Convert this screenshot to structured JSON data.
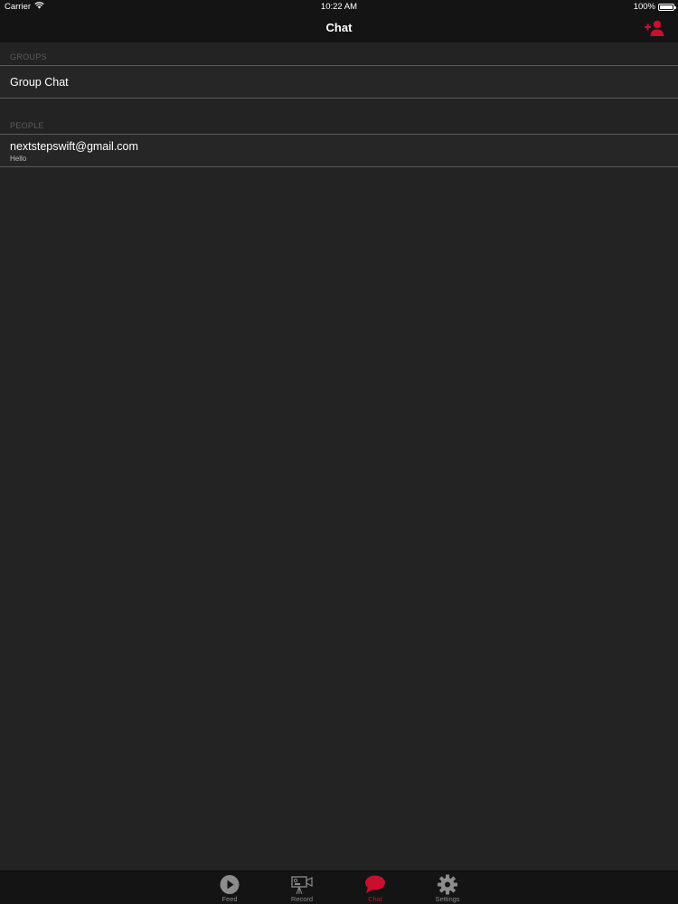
{
  "status_bar": {
    "carrier": "Carrier",
    "time": "10:22 AM",
    "battery": "100%"
  },
  "nav": {
    "title": "Chat",
    "add_user_icon": "add-user-icon"
  },
  "sections": {
    "groups": {
      "header": "GROUPS",
      "items": [
        {
          "title": "Group Chat"
        }
      ]
    },
    "people": {
      "header": "PEOPLE",
      "items": [
        {
          "title": "nextstepswift@gmail.com",
          "subtitle": "Hello"
        }
      ]
    }
  },
  "tab_bar": {
    "tabs": [
      {
        "label": "Feed",
        "icon": "play-icon",
        "active": false
      },
      {
        "label": "Record",
        "icon": "video-camera-icon",
        "active": false
      },
      {
        "label": "Chat",
        "icon": "chat-bubble-icon",
        "active": true
      },
      {
        "label": "Settings",
        "icon": "gear-icon",
        "active": false
      }
    ]
  },
  "colors": {
    "accent": "#c8102e",
    "background": "#232323",
    "bar": "#141414",
    "separator": "#5a5a5a",
    "section_header": "#5b5b5b",
    "inactive": "#8c8c8c"
  }
}
